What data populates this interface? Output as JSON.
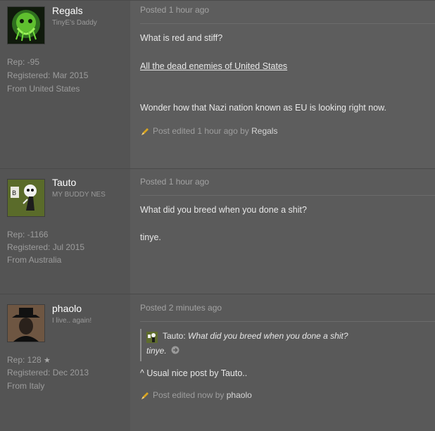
{
  "posts": [
    {
      "username": "Regals",
      "user_title": "TinyE's Daddy",
      "rep": "Rep: -95",
      "registered": "Registered: Mar 2015",
      "from": "From United States",
      "posted": "Posted 1 hour ago",
      "lines": [
        "What is red and stiff?",
        "All the dead enemies of United States",
        "Wonder how that Nazi nation known as EU is looking right now."
      ],
      "edited_prefix": "Post edited 1 hour ago by",
      "edited_by": "Regals",
      "avatar_icon": "green-skull-avatar"
    },
    {
      "username": "Tauto",
      "user_title": "MY BUDDY NES",
      "rep": "Rep: -1166",
      "registered": "Registered: Jul 2015",
      "from": "From Australia",
      "posted": "Posted 1 hour ago",
      "lines": [
        "What did you breed when you done a shit?",
        "tinye."
      ],
      "avatar_icon": "panda-sign-avatar"
    },
    {
      "username": "phaolo",
      "user_title": "I live.. again!",
      "rep": "Rep: 128",
      "rep_icon": "star-icon",
      "registered": "Registered: Dec 2013",
      "from": "From Italy",
      "posted": "Posted 2 minutes ago",
      "quote": {
        "author": "Tauto:",
        "text": "What did you breed when you done a shit?",
        "tail": "tinye."
      },
      "lines": [
        "^ Usual nice post by Tauto.."
      ],
      "edited_prefix": "Post edited now by",
      "edited_by": "phaolo",
      "avatar_icon": "hat-man-avatar"
    }
  ],
  "colors": {
    "background": "#5b5b5b",
    "author_panel": "#545454",
    "text": "#e8e8e8",
    "muted": "#9c9c9c"
  }
}
